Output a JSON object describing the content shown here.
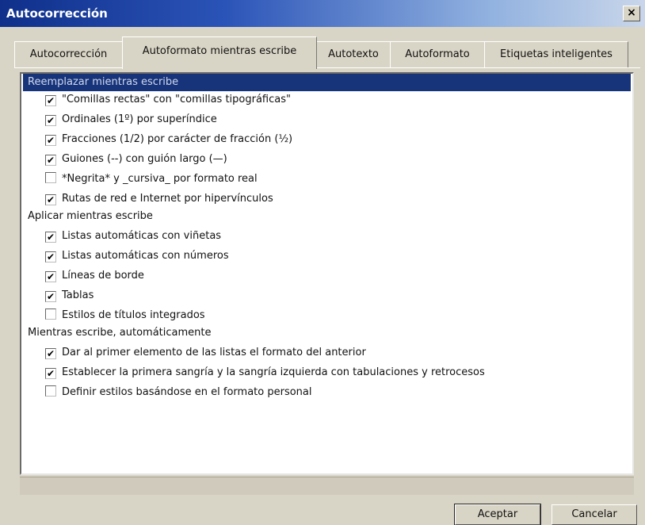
{
  "window": {
    "title": "Autocorrección",
    "close_glyph": "×"
  },
  "tabs": [
    {
      "label": "Autocorrección",
      "active": false
    },
    {
      "label": "Autoformato mientras escribe",
      "active": true
    },
    {
      "label": "Autotexto",
      "active": false
    },
    {
      "label": "Autoformato",
      "active": false
    },
    {
      "label": "Etiquetas inteligentes",
      "active": false
    }
  ],
  "groups": [
    {
      "title": "Reemplazar mientras escribe",
      "selected": true,
      "items": [
        {
          "label": "\"Comillas rectas\" con \"comillas tipográficas\"",
          "checked": true
        },
        {
          "label": "Ordinales (1º) por superíndice",
          "checked": true
        },
        {
          "label": "Fracciones (1/2) por carácter de fracción (½)",
          "checked": true
        },
        {
          "label": "Guiones (--) con guión largo (—)",
          "checked": true
        },
        {
          "label": "*Negrita* y _cursiva_ por formato real",
          "checked": false
        },
        {
          "label": "Rutas de red e Internet por hipervínculos",
          "checked": true
        }
      ]
    },
    {
      "title": "Aplicar mientras escribe",
      "selected": false,
      "items": [
        {
          "label": "Listas automáticas con viñetas",
          "checked": true
        },
        {
          "label": "Listas automáticas con números",
          "checked": true
        },
        {
          "label": "Líneas de borde",
          "checked": true
        },
        {
          "label": "Tablas",
          "checked": true
        },
        {
          "label": "Estilos de títulos integrados",
          "checked": false
        }
      ]
    },
    {
      "title": "Mientras escribe, automáticamente",
      "selected": false,
      "items": [
        {
          "label": "Dar al primer elemento de las listas el formato del anterior",
          "checked": true
        },
        {
          "label": "Establecer la primera sangría y la sangría izquierda con tabulaciones y retrocesos",
          "checked": true
        },
        {
          "label": "Definir estilos basándose en el formato personal",
          "checked": false
        }
      ]
    }
  ],
  "buttons": {
    "ok_label": "Aceptar",
    "cancel_label": "Cancelar"
  },
  "colors": {
    "title_gradient_start": "#0f2f8a",
    "selection": "#17347a",
    "dialog_face": "#d9d5c6"
  }
}
